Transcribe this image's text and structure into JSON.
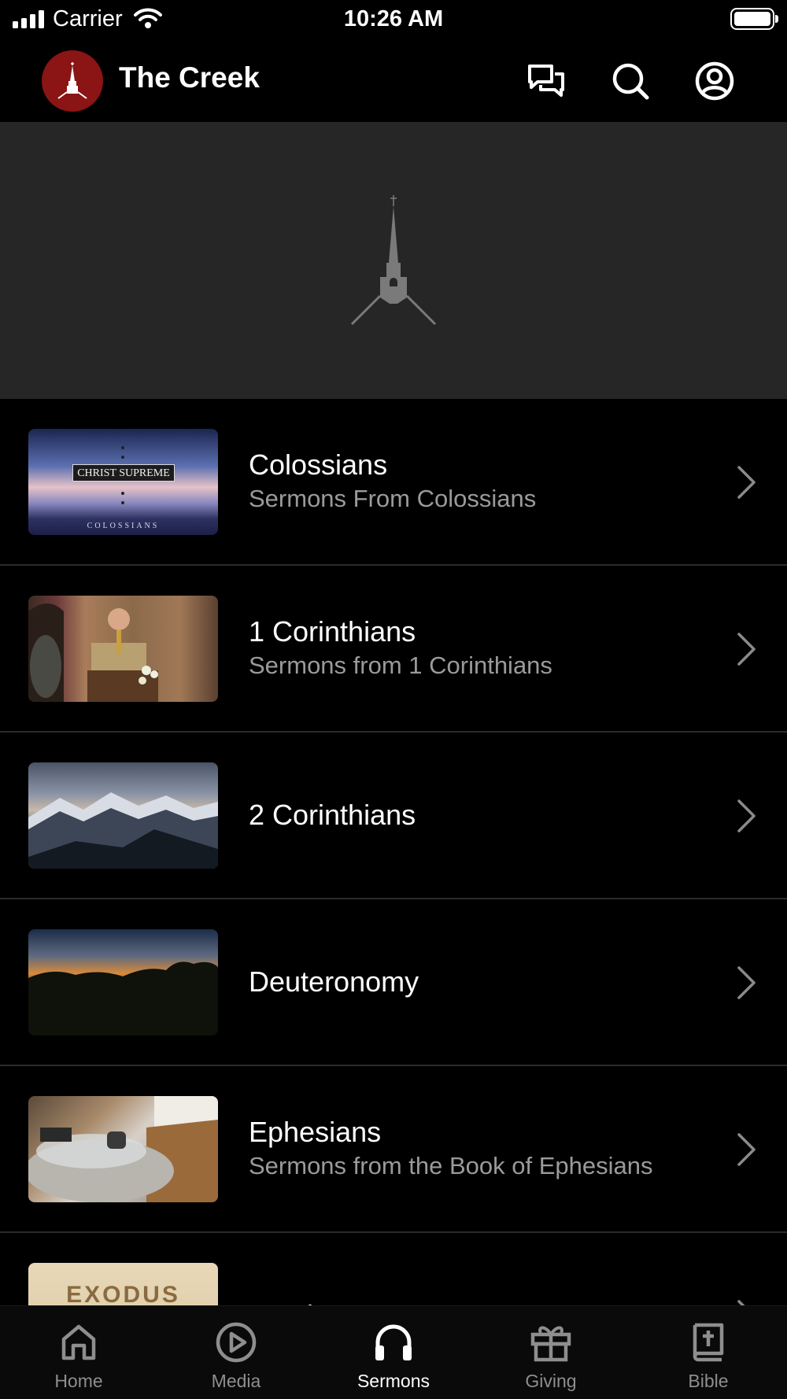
{
  "status_bar": {
    "carrier": "Carrier",
    "time": "10:26 AM"
  },
  "header": {
    "title": "The Creek",
    "logo_color": "#8b1414",
    "actions": [
      "chat-icon",
      "search-icon",
      "account-icon"
    ]
  },
  "series": [
    {
      "title": "Colossians",
      "subtitle": "Sermons From Colossians",
      "thumb_text": "CHRIST SUPREME",
      "thumb_subtext": "COLOSSIANS"
    },
    {
      "title": "1 Corinthians",
      "subtitle": "Sermons from 1 Corinthians"
    },
    {
      "title": "2 Corinthians",
      "subtitle": ""
    },
    {
      "title": "Deuteronomy",
      "subtitle": ""
    },
    {
      "title": "Ephesians",
      "subtitle": "Sermons from the Book of Ephesians"
    },
    {
      "title": "Exodus",
      "subtitle": "",
      "thumb_text": "EXODUS"
    }
  ],
  "tabs": [
    {
      "label": "Home",
      "icon": "home-icon",
      "active": false
    },
    {
      "label": "Media",
      "icon": "play-circle-icon",
      "active": false
    },
    {
      "label": "Sermons",
      "icon": "headphones-icon",
      "active": true
    },
    {
      "label": "Giving",
      "icon": "gift-icon",
      "active": false
    },
    {
      "label": "Bible",
      "icon": "bible-icon",
      "active": false
    }
  ],
  "colors": {
    "background": "#000000",
    "hero_background": "#262626",
    "subtitle_text": "#9a9a9a",
    "inactive_tab": "#8e8e8e",
    "active_tab": "#ffffff"
  }
}
